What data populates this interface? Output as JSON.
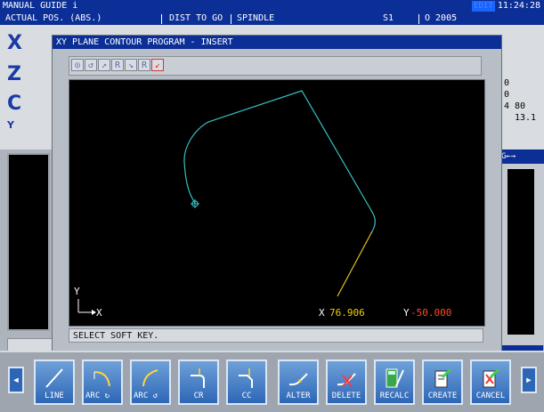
{
  "header": {
    "title": "MANUAL GUIDE i",
    "mode_badge": "EDIT",
    "clock": "11:24:28"
  },
  "header2": {
    "actual_pos": "ACTUAL POS. (ABS.)",
    "dist_to_go": "DIST TO GO",
    "spindle": "SPINDLE",
    "s1": "S1",
    "program": "O 2005"
  },
  "axes": [
    "X",
    "Z",
    "C",
    "Y"
  ],
  "right_values": [
    "0",
    "0",
    "4  80",
    "13.1"
  ],
  "side_label": "G←→",
  "dialog": {
    "title": "XY PLANE CONTOUR PROGRAM  - INSERT",
    "tools": [
      "◎",
      "↺",
      "↗",
      "R",
      "↘",
      "R",
      "↙"
    ],
    "x_label": "X",
    "x_value": "76.906",
    "y_label": "Y",
    "y_value": "-50.000",
    "axis_x": "X",
    "axis_y": "Y",
    "message": "SELECT SOFT KEY."
  },
  "softkeys": [
    {
      "label": "LINE",
      "icon": "line-icon"
    },
    {
      "label": "ARC",
      "icon": "arc-cw-icon"
    },
    {
      "label": "ARC",
      "icon": "arc-ccw-icon"
    },
    {
      "label": "CR",
      "icon": "corner-radius-icon"
    },
    {
      "label": "CC",
      "icon": "corner-chamfer-icon"
    },
    {
      "label": "ALTER",
      "icon": "alter-icon"
    },
    {
      "label": "DELETE",
      "icon": "delete-icon"
    },
    {
      "label": "RECALC",
      "icon": "recalc-icon"
    },
    {
      "label": "CREATE",
      "icon": "create-icon"
    },
    {
      "label": "CANCEL",
      "icon": "cancel-icon"
    }
  ],
  "colors": {
    "title_blue": "#0b2f96",
    "contour": "#37c1c1",
    "new_line": "#e8c21c",
    "readout_value": "#f0d000",
    "readout_y": "#ff4a2a"
  }
}
